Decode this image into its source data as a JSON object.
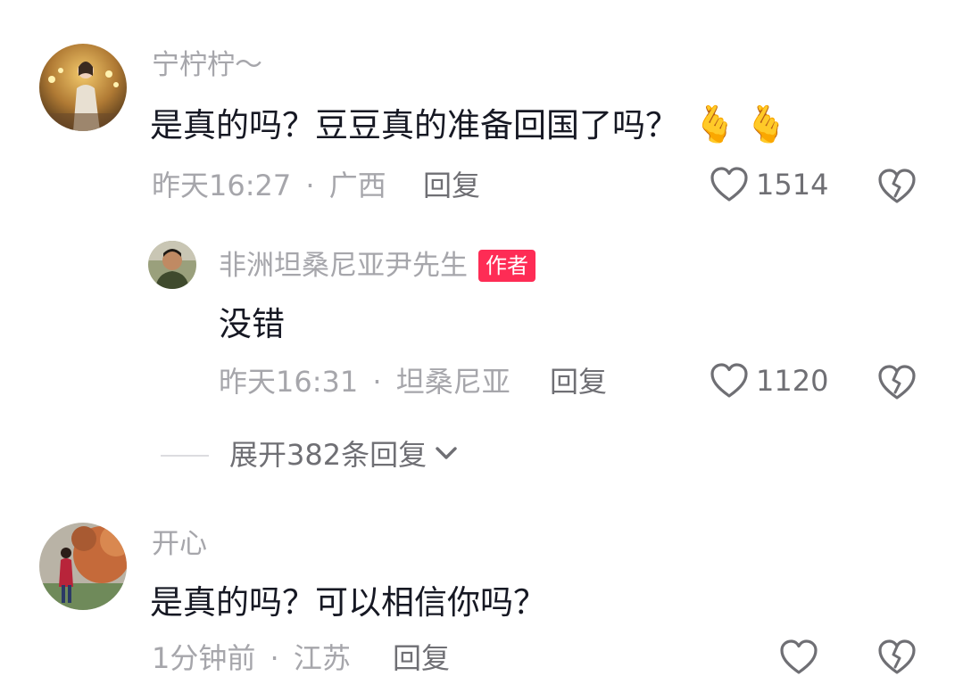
{
  "comments": [
    {
      "username": "宁柠柠～",
      "text": "是真的吗？豆豆真的准备回国了吗？",
      "emoji": "🫰🫰",
      "emoji_icon": "finger-heart-icon",
      "time": "昨天16:27",
      "location": "广西",
      "reply_label": "回复",
      "likes": "1514",
      "replies": [
        {
          "username": "非洲坦桑尼亚尹先生",
          "badge": "作者",
          "text": "没错",
          "time": "昨天16:31",
          "location": "坦桑尼亚",
          "reply_label": "回复",
          "likes": "1120"
        }
      ],
      "expand_label": "展开382条回复"
    },
    {
      "username": "开心",
      "text": "是真的吗？可以相信你吗？",
      "time": "1分钟前",
      "location": "江苏",
      "reply_label": "回复"
    }
  ],
  "meta_separator": "·",
  "colors": {
    "badge_bg": "#fe2c55",
    "muted_text": "#a6a6ab",
    "body_text": "#161823",
    "secondary_text": "#6f6f74"
  }
}
